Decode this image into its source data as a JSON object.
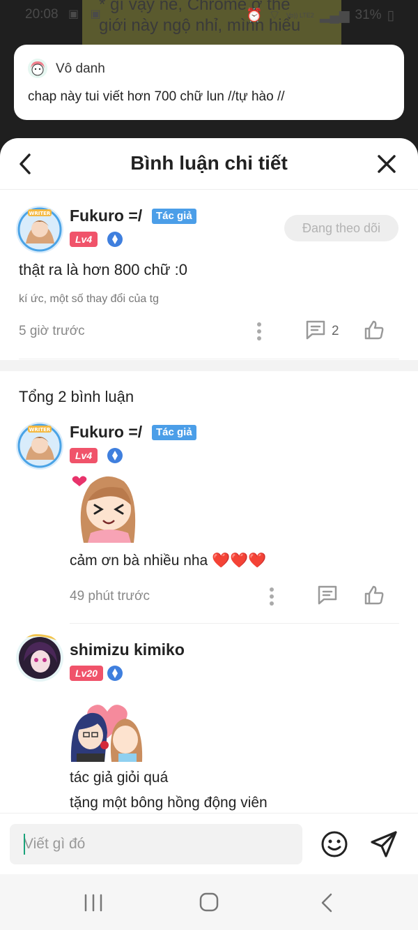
{
  "status_bar": {
    "time": "20:08",
    "signal_label": "Vo)) LTE2",
    "battery": "31%"
  },
  "background": {
    "text_line1": "* gì vậy nè, Chrome ở thế",
    "text_line2": "giới này ngộ nhỉ, mình hiểu"
  },
  "notification": {
    "username": "Vô danh",
    "message": "chap này tui viết hơn 700 chữ lun //tự hào //"
  },
  "header": {
    "title": "Bình luận chi tiết"
  },
  "main_comment": {
    "username": "Fukuro =/",
    "author_badge": "Tác giả",
    "level": "Lv4",
    "follow_label": "Đang theo dõi",
    "text": "thật ra là hơn 800 chữ :0",
    "subtext": "kí ức, một số thay đổi của tg",
    "time": "5 giờ trước",
    "reply_count": "2"
  },
  "replies_section": {
    "total_label": "Tổng 2 bình luận"
  },
  "replies": [
    {
      "username": "Fukuro =/",
      "author_badge": "Tác giả",
      "level": "Lv4",
      "text": "cảm ơn bà nhiều nha ❤️❤️❤️",
      "time": "49 phút trước"
    },
    {
      "username": "shimizu kimiko",
      "level": "Lv20",
      "text_line1": "tác giả giỏi quá",
      "text_line2": "tặng một bông hồng động viên"
    }
  ],
  "input": {
    "placeholder": "Viết gì đó"
  },
  "colors": {
    "author_badge": "#4b9ee8",
    "level_badge": "#f0536a",
    "caret": "#1aa37a"
  }
}
